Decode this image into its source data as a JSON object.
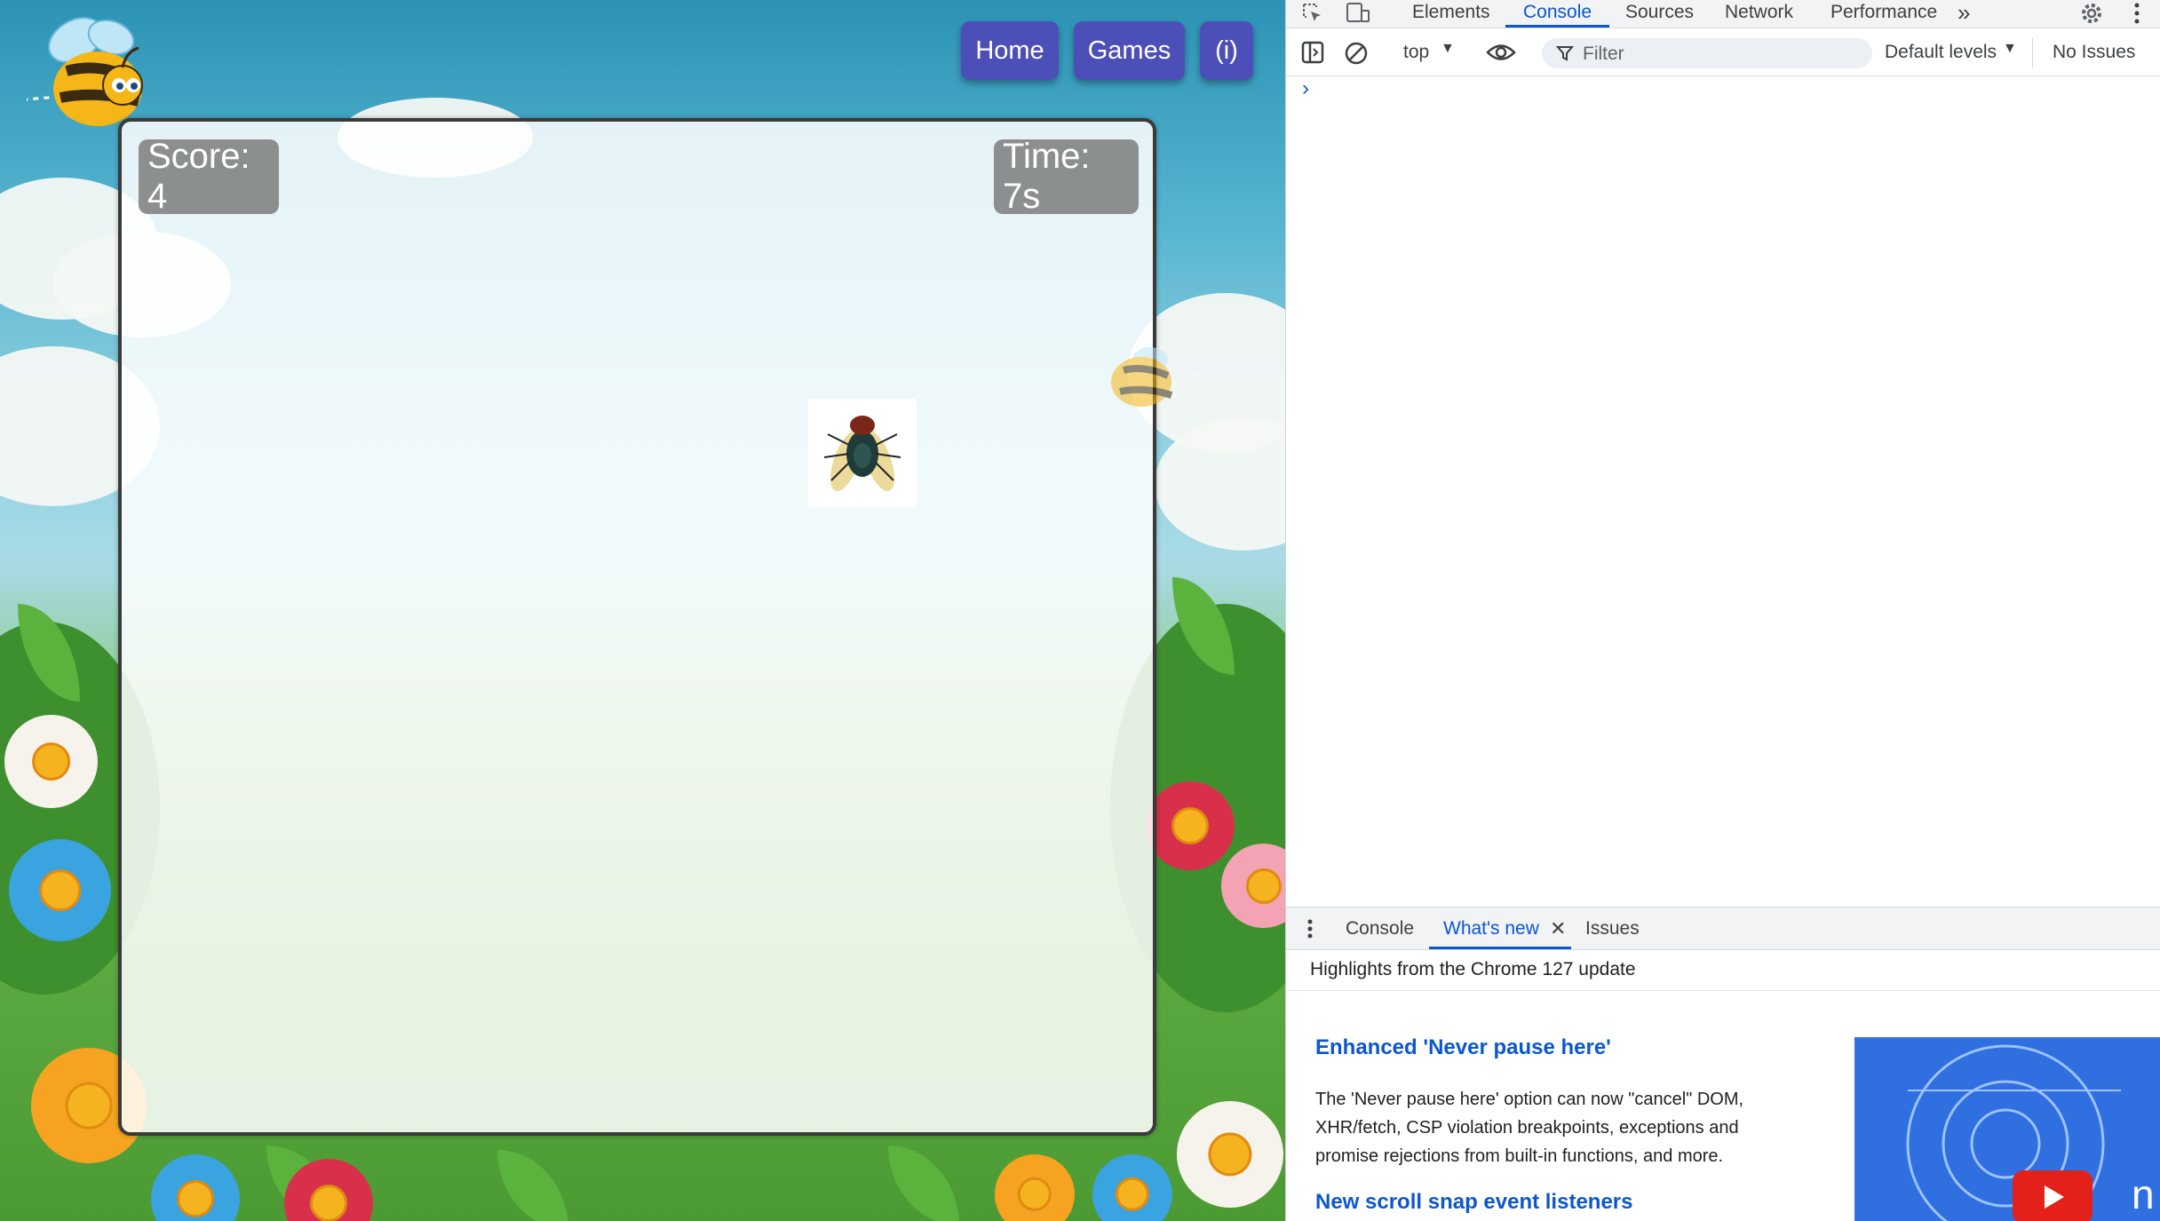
{
  "game": {
    "nav": {
      "home_label": "Home",
      "games_label": "Games",
      "info_label": "(i)"
    },
    "hud": {
      "score_text": "Score: 4",
      "time_text": "Time: 7s"
    },
    "target_icon": "fly-icon",
    "mascot_icon": "bee-icon"
  },
  "devtools": {
    "main_tabs": [
      "Elements",
      "Console",
      "Sources",
      "Network",
      "Performance"
    ],
    "active_tab": "Console",
    "more_tabs_glyph": "»",
    "toolbar": {
      "context": "top",
      "filter_placeholder": "Filter",
      "levels": "Default levels",
      "issues": "No Issues"
    },
    "console_prompt": "›",
    "drawer": {
      "tabs": [
        "Console",
        "What's new",
        "Issues"
      ],
      "active_tab": "What's new",
      "close_glyph": "✕",
      "highlights": "Highlights from the Chrome 127 update",
      "items": [
        {
          "title": "Enhanced 'Never pause here'",
          "description": "The 'Never pause here' option can now \"cancel\" DOM, XHR/fetch, CSP violation breakpoints, exceptions and promise rejections from built-in functions, and more."
        },
        {
          "title": "New scroll snap event listeners"
        }
      ],
      "thumb_text": "n"
    },
    "accent_color": "#0b57d0"
  }
}
